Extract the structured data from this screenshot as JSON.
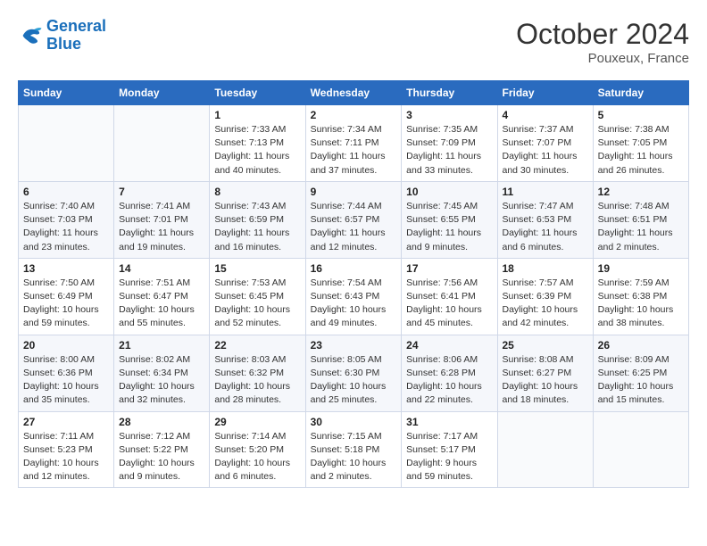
{
  "header": {
    "logo_general": "General",
    "logo_blue": "Blue",
    "month_title": "October 2024",
    "location": "Pouxeux, France"
  },
  "days_of_week": [
    "Sunday",
    "Monday",
    "Tuesday",
    "Wednesday",
    "Thursday",
    "Friday",
    "Saturday"
  ],
  "weeks": [
    [
      {
        "day": "",
        "info": ""
      },
      {
        "day": "",
        "info": ""
      },
      {
        "day": "1",
        "info": "Sunrise: 7:33 AM\nSunset: 7:13 PM\nDaylight: 11 hours and 40 minutes."
      },
      {
        "day": "2",
        "info": "Sunrise: 7:34 AM\nSunset: 7:11 PM\nDaylight: 11 hours and 37 minutes."
      },
      {
        "day": "3",
        "info": "Sunrise: 7:35 AM\nSunset: 7:09 PM\nDaylight: 11 hours and 33 minutes."
      },
      {
        "day": "4",
        "info": "Sunrise: 7:37 AM\nSunset: 7:07 PM\nDaylight: 11 hours and 30 minutes."
      },
      {
        "day": "5",
        "info": "Sunrise: 7:38 AM\nSunset: 7:05 PM\nDaylight: 11 hours and 26 minutes."
      }
    ],
    [
      {
        "day": "6",
        "info": "Sunrise: 7:40 AM\nSunset: 7:03 PM\nDaylight: 11 hours and 23 minutes."
      },
      {
        "day": "7",
        "info": "Sunrise: 7:41 AM\nSunset: 7:01 PM\nDaylight: 11 hours and 19 minutes."
      },
      {
        "day": "8",
        "info": "Sunrise: 7:43 AM\nSunset: 6:59 PM\nDaylight: 11 hours and 16 minutes."
      },
      {
        "day": "9",
        "info": "Sunrise: 7:44 AM\nSunset: 6:57 PM\nDaylight: 11 hours and 12 minutes."
      },
      {
        "day": "10",
        "info": "Sunrise: 7:45 AM\nSunset: 6:55 PM\nDaylight: 11 hours and 9 minutes."
      },
      {
        "day": "11",
        "info": "Sunrise: 7:47 AM\nSunset: 6:53 PM\nDaylight: 11 hours and 6 minutes."
      },
      {
        "day": "12",
        "info": "Sunrise: 7:48 AM\nSunset: 6:51 PM\nDaylight: 11 hours and 2 minutes."
      }
    ],
    [
      {
        "day": "13",
        "info": "Sunrise: 7:50 AM\nSunset: 6:49 PM\nDaylight: 10 hours and 59 minutes."
      },
      {
        "day": "14",
        "info": "Sunrise: 7:51 AM\nSunset: 6:47 PM\nDaylight: 10 hours and 55 minutes."
      },
      {
        "day": "15",
        "info": "Sunrise: 7:53 AM\nSunset: 6:45 PM\nDaylight: 10 hours and 52 minutes."
      },
      {
        "day": "16",
        "info": "Sunrise: 7:54 AM\nSunset: 6:43 PM\nDaylight: 10 hours and 49 minutes."
      },
      {
        "day": "17",
        "info": "Sunrise: 7:56 AM\nSunset: 6:41 PM\nDaylight: 10 hours and 45 minutes."
      },
      {
        "day": "18",
        "info": "Sunrise: 7:57 AM\nSunset: 6:39 PM\nDaylight: 10 hours and 42 minutes."
      },
      {
        "day": "19",
        "info": "Sunrise: 7:59 AM\nSunset: 6:38 PM\nDaylight: 10 hours and 38 minutes."
      }
    ],
    [
      {
        "day": "20",
        "info": "Sunrise: 8:00 AM\nSunset: 6:36 PM\nDaylight: 10 hours and 35 minutes."
      },
      {
        "day": "21",
        "info": "Sunrise: 8:02 AM\nSunset: 6:34 PM\nDaylight: 10 hours and 32 minutes."
      },
      {
        "day": "22",
        "info": "Sunrise: 8:03 AM\nSunset: 6:32 PM\nDaylight: 10 hours and 28 minutes."
      },
      {
        "day": "23",
        "info": "Sunrise: 8:05 AM\nSunset: 6:30 PM\nDaylight: 10 hours and 25 minutes."
      },
      {
        "day": "24",
        "info": "Sunrise: 8:06 AM\nSunset: 6:28 PM\nDaylight: 10 hours and 22 minutes."
      },
      {
        "day": "25",
        "info": "Sunrise: 8:08 AM\nSunset: 6:27 PM\nDaylight: 10 hours and 18 minutes."
      },
      {
        "day": "26",
        "info": "Sunrise: 8:09 AM\nSunset: 6:25 PM\nDaylight: 10 hours and 15 minutes."
      }
    ],
    [
      {
        "day": "27",
        "info": "Sunrise: 7:11 AM\nSunset: 5:23 PM\nDaylight: 10 hours and 12 minutes."
      },
      {
        "day": "28",
        "info": "Sunrise: 7:12 AM\nSunset: 5:22 PM\nDaylight: 10 hours and 9 minutes."
      },
      {
        "day": "29",
        "info": "Sunrise: 7:14 AM\nSunset: 5:20 PM\nDaylight: 10 hours and 6 minutes."
      },
      {
        "day": "30",
        "info": "Sunrise: 7:15 AM\nSunset: 5:18 PM\nDaylight: 10 hours and 2 minutes."
      },
      {
        "day": "31",
        "info": "Sunrise: 7:17 AM\nSunset: 5:17 PM\nDaylight: 9 hours and 59 minutes."
      },
      {
        "day": "",
        "info": ""
      },
      {
        "day": "",
        "info": ""
      }
    ]
  ]
}
